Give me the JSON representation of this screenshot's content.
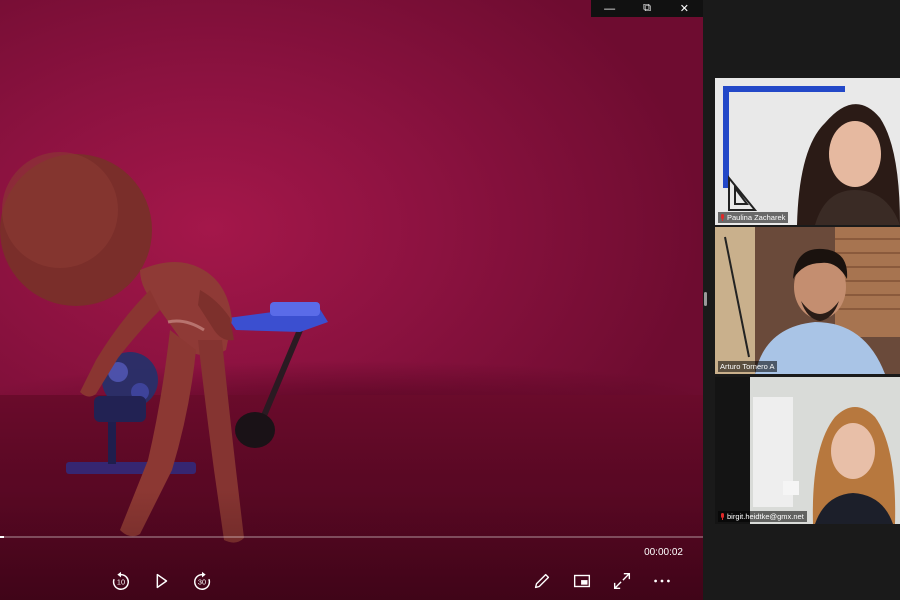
{
  "window": {
    "minimize_icon": "minimize-icon",
    "restore_icon": "restore-icon",
    "close_icon": "close-icon",
    "minimize_glyph": "—",
    "restore_glyph": "⧉",
    "close_glyph": "✕"
  },
  "player": {
    "time": "00:00:02",
    "progress": 0.005,
    "controls": {
      "skip_back_seconds": "10",
      "skip_forward_seconds": "30",
      "icons": [
        "replay-10-icon",
        "play-icon",
        "forward-30-icon",
        "edit-pen-icon",
        "mini-view-icon",
        "fullscreen-icon",
        "more-options-icon"
      ]
    }
  },
  "participants": [
    {
      "name": "Paulina Zacharek",
      "muted": true,
      "active": false
    },
    {
      "name": "Arturo Tornero A",
      "muted": false,
      "active": true
    },
    {
      "name": "birgit.heidtke@gmx.net",
      "muted": true,
      "active": false
    }
  ],
  "colors": {
    "video_background": "#8c1240",
    "active_speaker_border": "#e6e03b",
    "muted_icon": "#e02828",
    "sidebar_background": "#1a1a1a"
  }
}
